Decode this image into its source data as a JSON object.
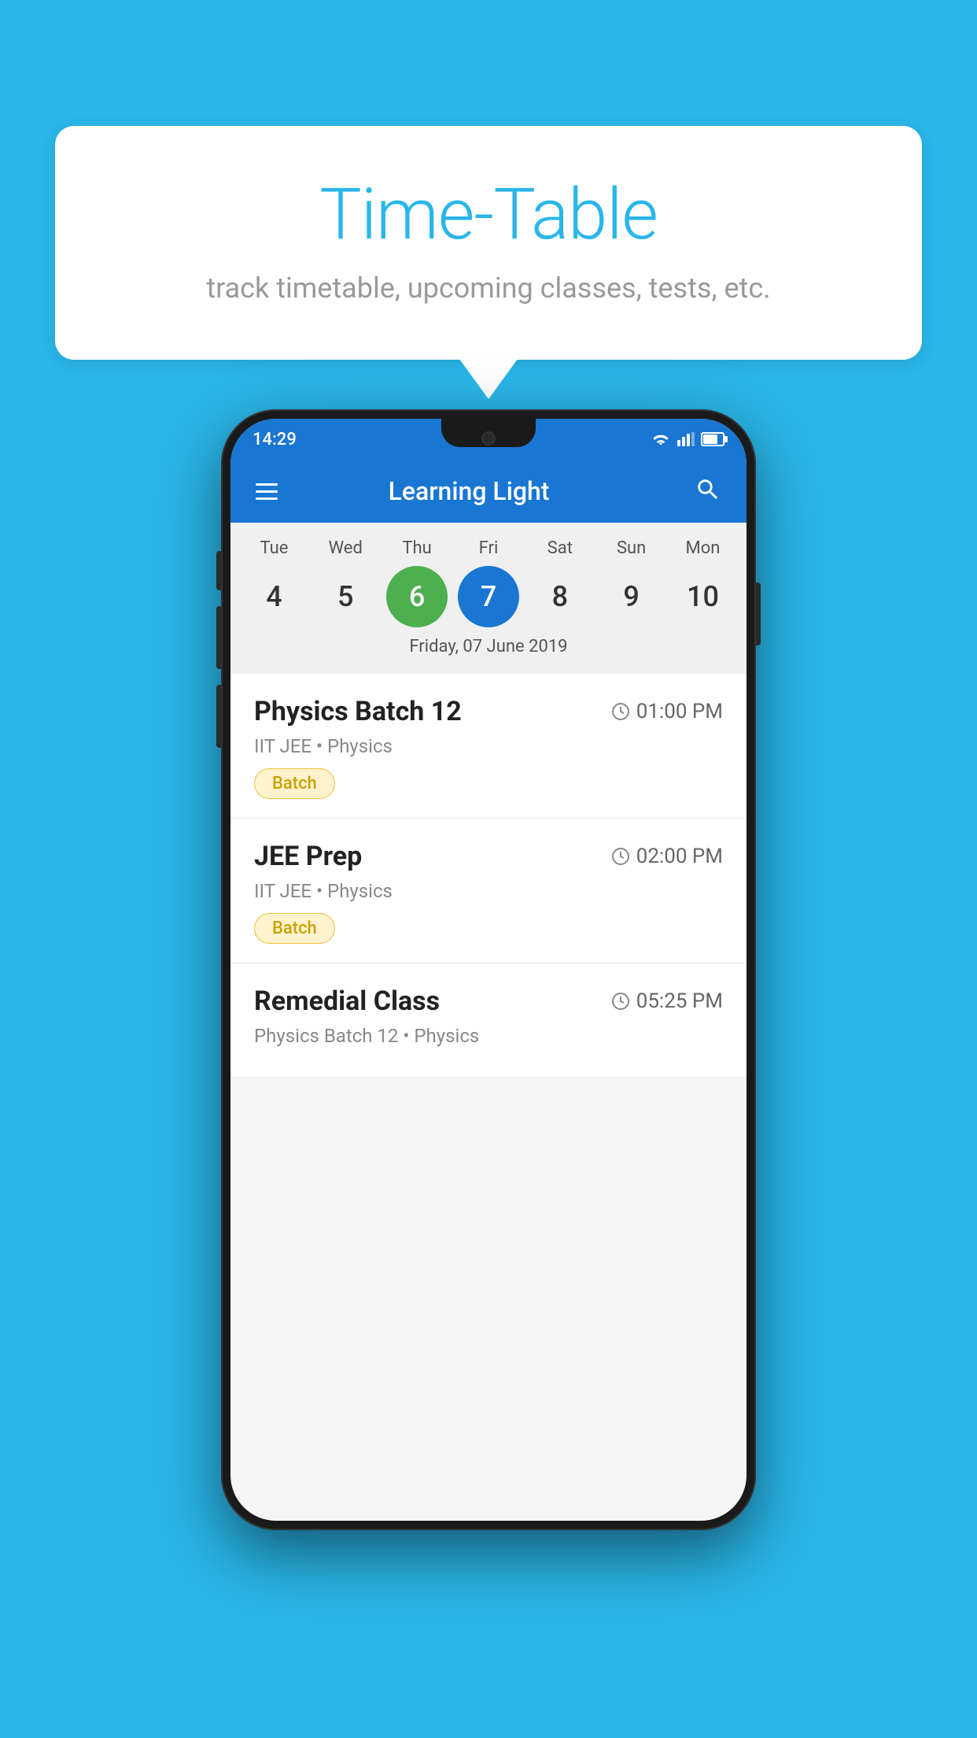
{
  "background": {
    "color": "#29B6E8"
  },
  "speech_bubble": {
    "title": "Time-Table",
    "subtitle": "track timetable, upcoming classes, tests, etc."
  },
  "phone": {
    "status_bar": {
      "time": "14:29"
    },
    "app_bar": {
      "title": "Learning Light"
    },
    "calendar": {
      "days": [
        {
          "label": "Tue",
          "number": "4"
        },
        {
          "label": "Wed",
          "number": "5"
        },
        {
          "label": "Thu",
          "number": "6",
          "state": "today"
        },
        {
          "label": "Fri",
          "number": "7",
          "state": "selected"
        },
        {
          "label": "Sat",
          "number": "8"
        },
        {
          "label": "Sun",
          "number": "9"
        },
        {
          "label": "Mon",
          "number": "10"
        }
      ],
      "selected_date": "Friday, 07 June 2019"
    },
    "schedule": [
      {
        "title": "Physics Batch 12",
        "time": "01:00 PM",
        "subtitle": "IIT JEE • Physics",
        "badge": "Batch"
      },
      {
        "title": "JEE Prep",
        "time": "02:00 PM",
        "subtitle": "IIT JEE • Physics",
        "badge": "Batch"
      },
      {
        "title": "Remedial Class",
        "time": "05:25 PM",
        "subtitle": "Physics Batch 12 • Physics",
        "badge": ""
      }
    ]
  }
}
